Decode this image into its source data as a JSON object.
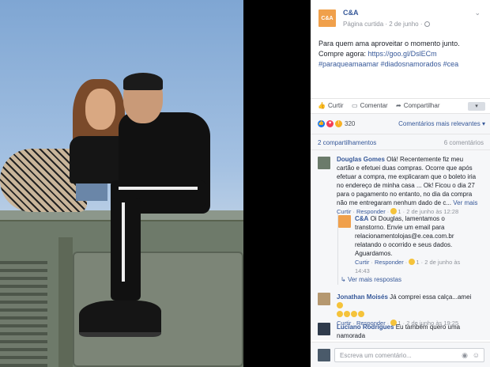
{
  "post": {
    "page_name": "C&A",
    "logo_text": "C&A",
    "subline": "Página curtida · 2 de junho ·",
    "text_line1": "Para quem ama aproveitar o momento junto.",
    "text_line2_prefix": "Compre agora: ",
    "link": "https://goo.gl/DslECm",
    "hashtags": "#paraqueamaamar #diadosnamorados #cea"
  },
  "actions": {
    "like": "Curtir",
    "comment": "Comentar",
    "share": "Compartilhar"
  },
  "reactions": {
    "count": "320",
    "sort_label": "Comentários mais relevantes",
    "shares_label": "2 compartilhamentos",
    "comments_label": "6 comentários"
  },
  "comments": [
    {
      "name": "Douglas Gomes",
      "text": "Olá! Recentemente fiz meu cartão e efetuei duas compras. Ocorre que após efetuar a compra, me explicaram que o boleto iria no endereço de minha casa ... Ok! Ficou o dia 27 para o pagamento no entanto, no dia da compra não me entregaram nenhum dado de c...",
      "more": "Ver mais",
      "like": "Curtir",
      "reply": "Responder",
      "reacts": "1",
      "date": "2 de junho às 12:28"
    },
    {
      "name": "C&A",
      "text": "Oi Douglas, lamentamos o transtorno. Envie um email para relacionamentolojas@e.cea.com.br relatando o ocorrido e seus dados. Aguardamos.",
      "like": "Curtir",
      "reply": "Responder",
      "reacts": "1",
      "date": "2 de junho às 14:43"
    },
    {
      "more_replies": "Ver mais respostas"
    },
    {
      "name": "Jonathan Moisés",
      "text": "Já comprei essa calça...amei",
      "like": "Curtir",
      "reply": "Responder",
      "reacts": "1",
      "date": "2 de junho às 19:25"
    },
    {
      "name": "Luciano Rodrigues",
      "text": "Eu também quero uma namorada"
    }
  ],
  "composer": {
    "placeholder": "Escreva um comentário..."
  },
  "colors": {
    "link": "#365899",
    "brand_orange": "#f0a04b"
  }
}
